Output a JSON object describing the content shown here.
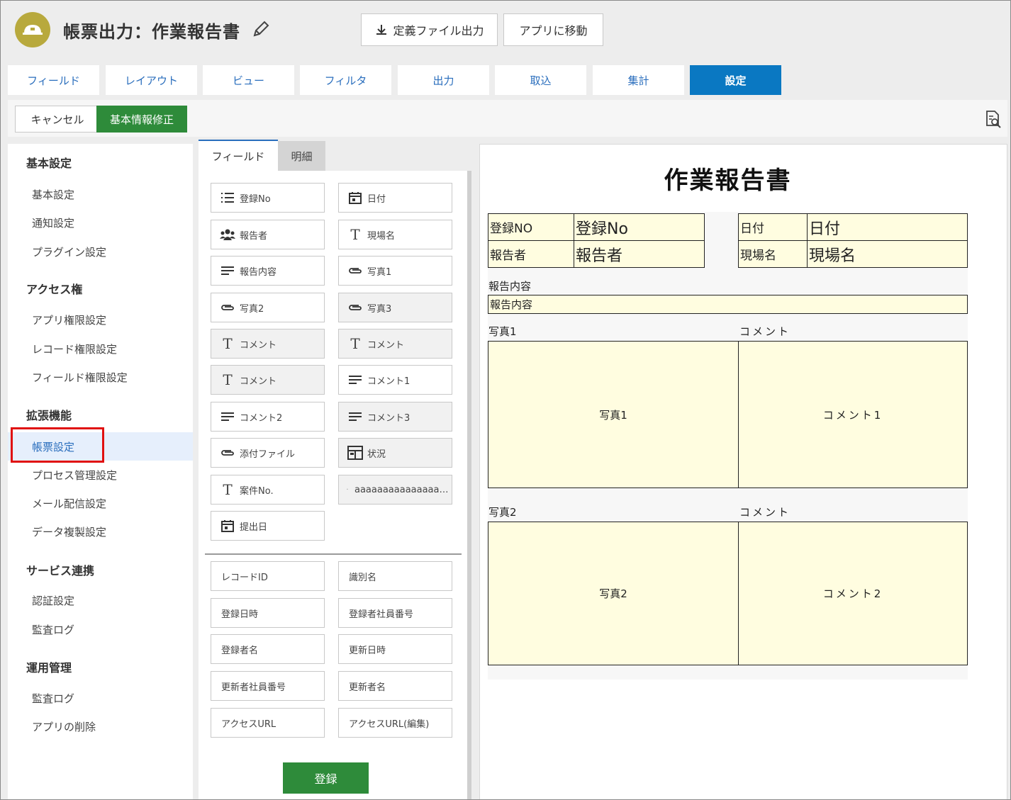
{
  "header": {
    "title": "帳票出力：作業報告書",
    "export_button": "定義ファイル出力",
    "goto_app_button": "アプリに移動"
  },
  "tabs": [
    {
      "label": "フィールド"
    },
    {
      "label": "レイアウト"
    },
    {
      "label": "ビュー"
    },
    {
      "label": "フィルタ"
    },
    {
      "label": "出力"
    },
    {
      "label": "取込"
    },
    {
      "label": "集計"
    },
    {
      "label": "設定",
      "active": true
    }
  ],
  "toolbar": {
    "cancel_label": "キャンセル",
    "edit_basic_label": "基本情報修正"
  },
  "sidebar": {
    "sections": [
      {
        "title": "基本設定",
        "items": [
          "基本設定",
          "通知設定",
          "プラグイン設定"
        ]
      },
      {
        "title": "アクセス権",
        "items": [
          "アプリ権限設定",
          "レコード権限設定",
          "フィールド権限設定"
        ]
      },
      {
        "title": "拡張機能",
        "items": [
          "帳票設定",
          "プロセス管理設定",
          "メール配信設定",
          "データ複製設定"
        ]
      },
      {
        "title": "サービス連携",
        "items": [
          "認証設定",
          "監査ログ"
        ]
      },
      {
        "title": "運用管理",
        "items": [
          "監査ログ",
          "アプリの削除"
        ]
      }
    ],
    "active_item": "帳票設定"
  },
  "middle": {
    "tab_field": "フィールド",
    "tab_detail": "明細",
    "fields": [
      {
        "label": "登録No",
        "icon": "list-number-icon"
      },
      {
        "label": "日付",
        "icon": "calendar-icon"
      },
      {
        "label": "報告者",
        "icon": "users-icon"
      },
      {
        "label": "現場名",
        "icon": "text-icon"
      },
      {
        "label": "報告内容",
        "icon": "multiline-icon"
      },
      {
        "label": "写真1",
        "icon": "attachment-icon"
      },
      {
        "label": "写真2",
        "icon": "attachment-icon"
      },
      {
        "label": "写真3",
        "icon": "attachment-icon"
      },
      {
        "label": "コメント",
        "icon": "text-icon"
      },
      {
        "label": "コメント",
        "icon": "text-icon"
      },
      {
        "label": "コメント",
        "icon": "text-icon"
      },
      {
        "label": "コメント1",
        "icon": "multiline-icon"
      },
      {
        "label": "コメント2",
        "icon": "multiline-icon"
      },
      {
        "label": "コメント3",
        "icon": "multiline-icon"
      },
      {
        "label": "添付ファイル",
        "icon": "attachment-icon"
      },
      {
        "label": "状況",
        "icon": "status-icon"
      },
      {
        "label": "案件No.",
        "icon": "text-icon"
      },
      {
        "label": "aaaaaaaaaaaaaaa…",
        "icon": "dot-icon"
      },
      {
        "label": "提出日",
        "icon": "calendar-icon"
      }
    ],
    "system_fields": [
      "レコードID",
      "識別名",
      "登録日時",
      "登録者社員番号",
      "登録者名",
      "更新日時",
      "更新者社員番号",
      "更新者名",
      "アクセスURL",
      "アクセスURL(編集)"
    ],
    "register_label": "登録"
  },
  "report": {
    "title": "作業報告書",
    "row1_label_a": "登録NO",
    "row1_value_a": "登録No",
    "row1_label_b": "日付",
    "row1_value_b": "日付",
    "row2_label_a": "報告者",
    "row2_value_a": "報告者",
    "row2_label_b": "現場名",
    "row2_value_b": "現場名",
    "content_label": "報告内容",
    "content_value": "報告内容",
    "photo1_label": "写真1",
    "comment_label_1": "コメント",
    "photo1_box": "写真1",
    "comment1_box": "コメント1",
    "photo2_label": "写真2",
    "comment_label_2": "コメント",
    "photo2_box": "写真2",
    "comment2_box": "コメント2"
  },
  "colors": {
    "tab_active": "#0a78c2",
    "primary_green": "#2e8b3a",
    "link_blue": "#2a6ebd",
    "highlight_red": "#e01010",
    "report_cell": "#fffde0"
  }
}
